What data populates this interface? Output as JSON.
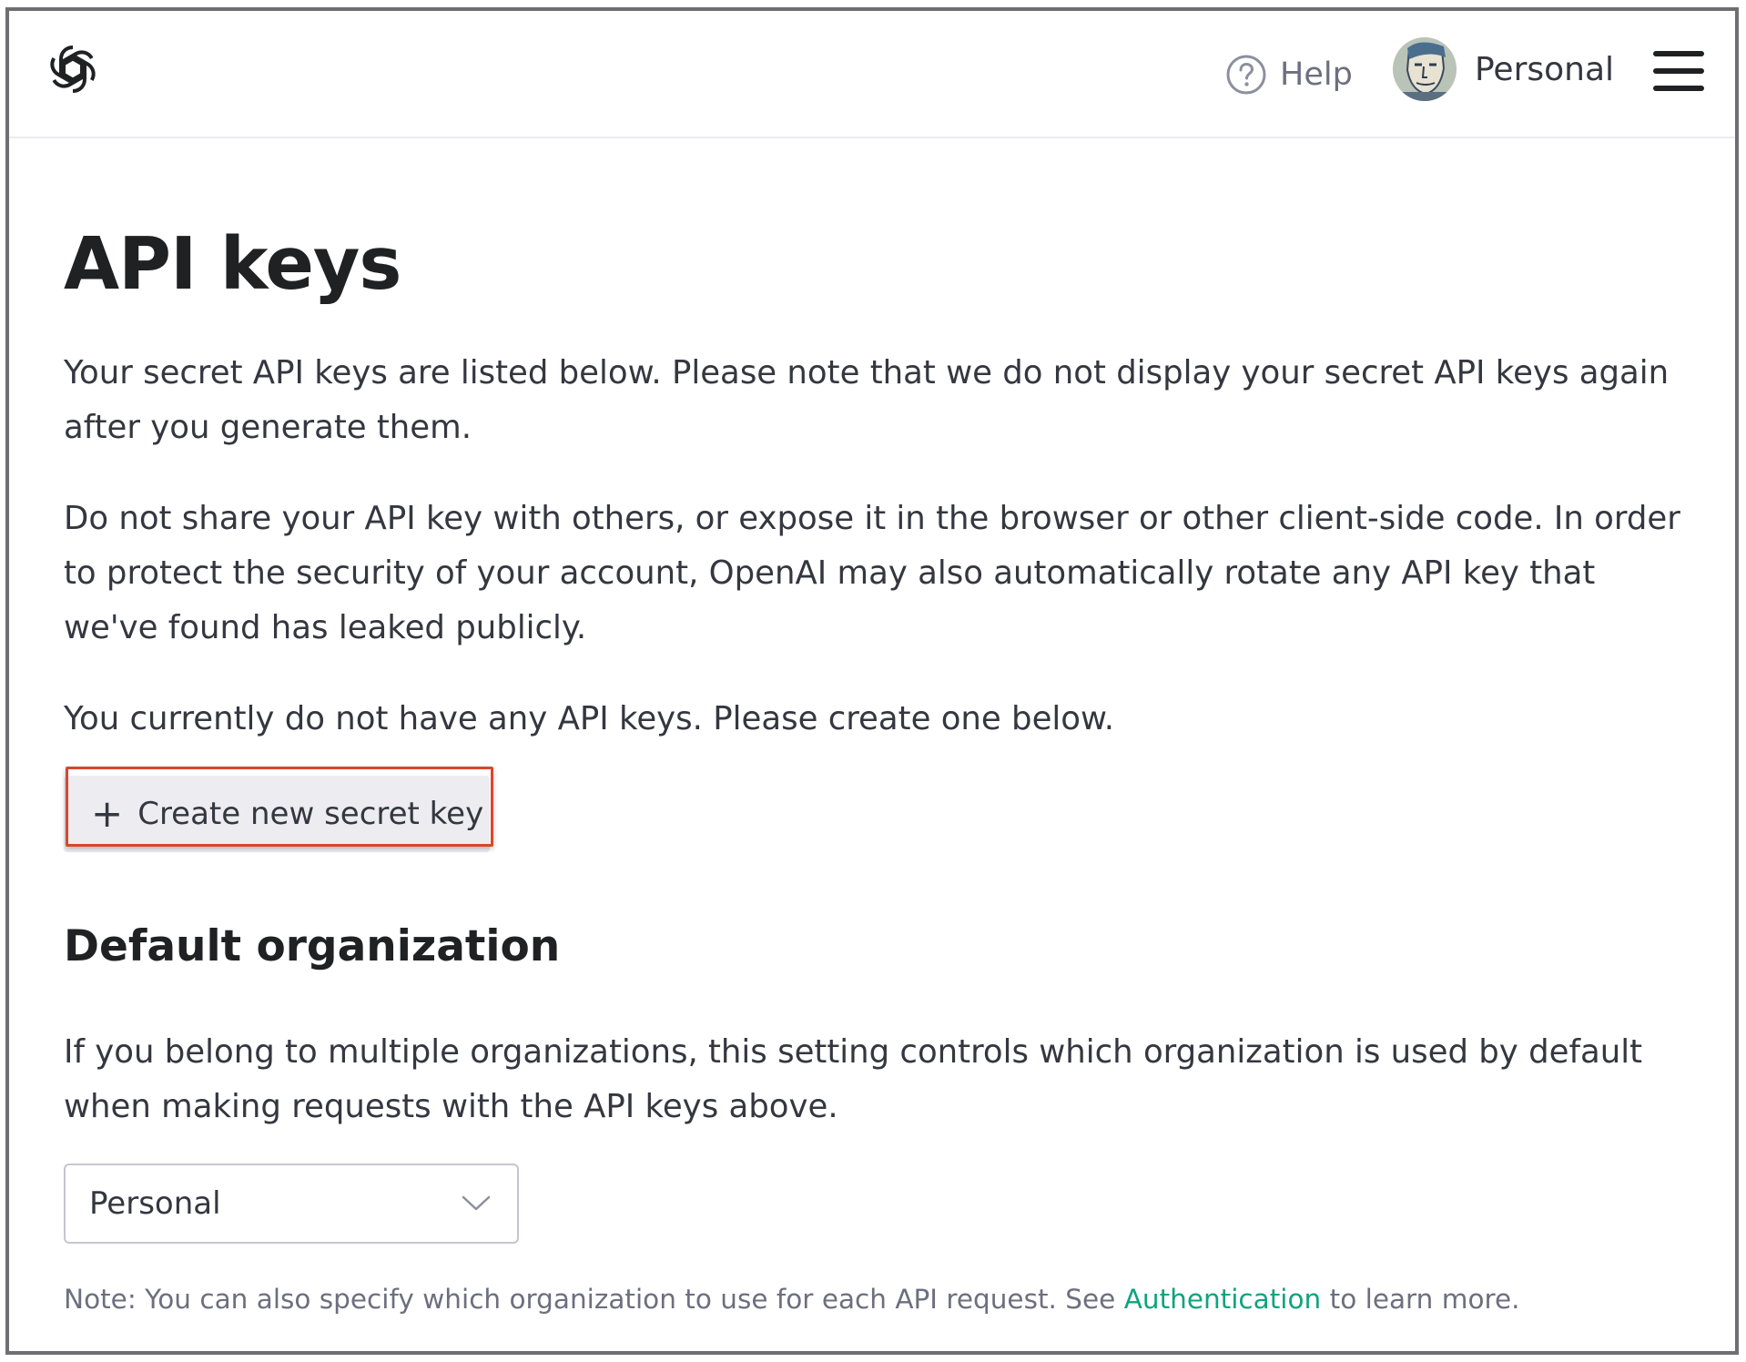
{
  "header": {
    "help_label": "Help",
    "account_name": "Personal"
  },
  "page": {
    "title": "API keys",
    "intro_1": "Your secret API keys are listed below. Please note that we do not display your secret API keys again after you generate them.",
    "intro_2": "Do not share your API key with others, or expose it in the browser or other client-side code. In order to protect the security of your account, OpenAI may also automatically rotate any API key that we've found has leaked publicly.",
    "empty_state": "You currently do not have any API keys. Please create one below.",
    "create_button": "Create new secret key",
    "create_icon": "+"
  },
  "default_org": {
    "title": "Default organization",
    "description": "If you belong to multiple organizations, this setting controls which organization is used by default when making requests with the API keys above.",
    "selected": "Personal",
    "note_prefix": "Note: You can also specify which organization to use for each API request. See ",
    "note_link": "Authentication",
    "note_suffix": " to learn more."
  },
  "colors": {
    "accent_link": "#10a37f",
    "highlight": "#d9462d",
    "button_bg": "#ececf1"
  },
  "icons": {
    "logo": "openai-logo-icon",
    "help": "question-circle-icon",
    "menu": "hamburger-menu-icon",
    "select": "chevron-down-icon"
  }
}
